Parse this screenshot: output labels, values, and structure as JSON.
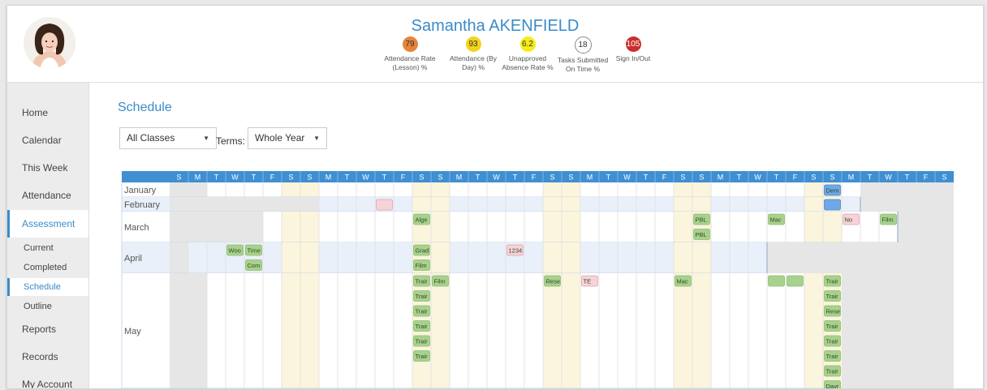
{
  "header": {
    "student_name": "Samantha AKENFIELD",
    "stats": [
      {
        "value": "79",
        "label_line1": "Attendance Rate",
        "label_line2": "(Lesson) %",
        "color": "#e8833a"
      },
      {
        "value": "93",
        "label_line1": "Attendance (By",
        "label_line2": "Day) %",
        "color": "#f2d41c"
      },
      {
        "value": "6.2",
        "label_line1": "Unapproved",
        "label_line2": "Absence Rate %",
        "color": "#f5ec1a"
      },
      {
        "value": "18",
        "label_line1": "Tasks Submitted",
        "label_line2": "On Time %",
        "color": "#ffffff"
      },
      {
        "value": "105",
        "label_line1": "Sign In/Out",
        "label_line2": "",
        "color": "#c9302c"
      }
    ]
  },
  "sidebar": {
    "items": [
      "Home",
      "Calendar",
      "This Week",
      "Attendance",
      "Assessment",
      "Reports",
      "Records",
      "My Account"
    ],
    "active": "Assessment",
    "sub_items": [
      "Current",
      "Completed",
      "Schedule",
      "Outline"
    ],
    "active_sub": "Schedule"
  },
  "main": {
    "title": "Schedule",
    "class_filter": "All Classes",
    "terms_label": "Terms:",
    "terms_value": "Whole Year"
  },
  "calendar": {
    "day_letters": [
      "S",
      "M",
      "T",
      "W",
      "T",
      "F",
      "S",
      "S",
      "M",
      "T",
      "W",
      "T",
      "F",
      "S",
      "S",
      "M",
      "T",
      "W",
      "T",
      "F",
      "S",
      "S",
      "M",
      "T",
      "W",
      "T",
      "F",
      "S",
      "S",
      "M",
      "T",
      "W",
      "T",
      "F",
      "S",
      "S",
      "M",
      "T",
      "W",
      "T",
      "F",
      "S"
    ],
    "months": [
      "January",
      "February",
      "March",
      "April",
      "May"
    ],
    "events": [
      {
        "month": "January",
        "day": 35,
        "line": 0,
        "text": "Dem",
        "color": "#6fa8e8"
      },
      {
        "month": "February",
        "day": 11,
        "line": 0,
        "text": "",
        "color": "#f6d3d8"
      },
      {
        "month": "February",
        "day": 35,
        "line": 0,
        "text": "",
        "color": "#6fa8e8"
      },
      {
        "month": "March",
        "day": 13,
        "line": 0,
        "text": "Alge",
        "color": "#a9d18e"
      },
      {
        "month": "March",
        "day": 28,
        "line": 0,
        "text": "PBL",
        "color": "#a9d18e"
      },
      {
        "month": "March",
        "day": 28,
        "line": 1,
        "text": "PBL",
        "color": "#a9d18e"
      },
      {
        "month": "March",
        "day": 32,
        "line": 0,
        "text": "Mac",
        "color": "#a9d18e"
      },
      {
        "month": "March",
        "day": 36,
        "line": 0,
        "text": "No",
        "color": "#f6d3d8"
      },
      {
        "month": "March",
        "day": 38,
        "line": 0,
        "text": "Film",
        "color": "#a9d18e"
      },
      {
        "month": "April",
        "day": 3,
        "line": 0,
        "text": "Woo",
        "color": "#a9d18e"
      },
      {
        "month": "April",
        "day": 4,
        "line": 0,
        "text": "Time",
        "color": "#a9d18e"
      },
      {
        "month": "April",
        "day": 4,
        "line": 1,
        "text": "Com",
        "color": "#a9d18e"
      },
      {
        "month": "April",
        "day": 13,
        "line": 0,
        "text": "Grad",
        "color": "#a9d18e"
      },
      {
        "month": "April",
        "day": 13,
        "line": 1,
        "text": "Film",
        "color": "#a9d18e"
      },
      {
        "month": "April",
        "day": 18,
        "line": 0,
        "text": "1234",
        "color": "#f6d3d8"
      },
      {
        "month": "May",
        "day": 13,
        "line": 0,
        "text": "Trair",
        "color": "#a9d18e"
      },
      {
        "month": "May",
        "day": 13,
        "line": 1,
        "text": "Trair",
        "color": "#a9d18e"
      },
      {
        "month": "May",
        "day": 13,
        "line": 2,
        "text": "Trair",
        "color": "#a9d18e"
      },
      {
        "month": "May",
        "day": 13,
        "line": 3,
        "text": "Trair",
        "color": "#a9d18e"
      },
      {
        "month": "May",
        "day": 13,
        "line": 4,
        "text": "Trair",
        "color": "#a9d18e"
      },
      {
        "month": "May",
        "day": 13,
        "line": 5,
        "text": "Trair",
        "color": "#a9d18e"
      },
      {
        "month": "May",
        "day": 14,
        "line": 0,
        "text": "Film",
        "color": "#a9d18e"
      },
      {
        "month": "May",
        "day": 20,
        "line": 0,
        "text": "Rese",
        "color": "#a9d18e"
      },
      {
        "month": "May",
        "day": 22,
        "line": 0,
        "text": "TE",
        "color": "#f6d3d8"
      },
      {
        "month": "May",
        "day": 27,
        "line": 0,
        "text": "Mac",
        "color": "#a9d18e"
      },
      {
        "month": "May",
        "day": 32,
        "line": 0,
        "text": "",
        "color": "#a9d18e"
      },
      {
        "month": "May",
        "day": 33,
        "line": 0,
        "text": "",
        "color": "#a9d18e"
      },
      {
        "month": "May",
        "day": 35,
        "line": 0,
        "text": "Trair",
        "color": "#a9d18e"
      },
      {
        "month": "May",
        "day": 35,
        "line": 1,
        "text": "Trair",
        "color": "#a9d18e"
      },
      {
        "month": "May",
        "day": 35,
        "line": 2,
        "text": "Rese",
        "color": "#a9d18e"
      },
      {
        "month": "May",
        "day": 35,
        "line": 3,
        "text": "Trair",
        "color": "#a9d18e"
      },
      {
        "month": "May",
        "day": 35,
        "line": 4,
        "text": "Trair",
        "color": "#a9d18e"
      },
      {
        "month": "May",
        "day": 35,
        "line": 5,
        "text": "Trair",
        "color": "#a9d18e"
      },
      {
        "month": "May",
        "day": 35,
        "line": 6,
        "text": "Trair",
        "color": "#a9d18e"
      },
      {
        "month": "May",
        "day": 35,
        "line": 7,
        "text": "Dayr",
        "color": "#a9d18e"
      }
    ]
  },
  "colors": {
    "accent": "#3a8bc9",
    "header_bar": "#3f8fd2",
    "weekend_shade": "#faf5dc",
    "row_highlight": "#e9f0fa",
    "outside_month": "#e6e6e6"
  }
}
